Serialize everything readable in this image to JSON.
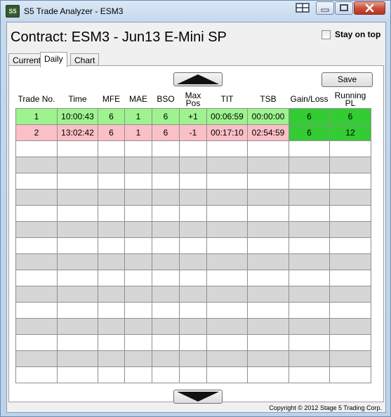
{
  "window": {
    "app_icon_text": "S5",
    "title": "S5 Trade Analyzer - ESM3"
  },
  "header": {
    "contract": "Contract: ESM3 - Jun13 E-Mini SP",
    "stay_on_top_label": "Stay on top",
    "stay_on_top_checked": false
  },
  "tabs": [
    {
      "label": "Current",
      "active": false
    },
    {
      "label": "Daily",
      "active": true
    },
    {
      "label": "Chart",
      "active": false
    }
  ],
  "toolbar": {
    "save_label": "Save"
  },
  "table": {
    "columns": [
      "Trade No.",
      "Time",
      "MFE",
      "MAE",
      "BSO",
      "Max\nPos",
      "TIT",
      "TSB",
      "Gain/Loss",
      "Running PL"
    ],
    "rows": [
      {
        "status": "win",
        "cells": [
          "1",
          "10:00:43",
          "6",
          "1",
          "6",
          "+1",
          "00:06:59",
          "00:00:00",
          "6",
          "6"
        ]
      },
      {
        "status": "loss",
        "cells": [
          "2",
          "13:02:42",
          "6",
          "1",
          "6",
          "-1",
          "00:17:10",
          "02:54:59",
          "6",
          "12"
        ]
      }
    ],
    "empty_rows": 15
  },
  "colors": {
    "win_row": "#9ef38f",
    "loss_row": "#fbbfc8",
    "money_cell": "#33cc33",
    "alt_row": "#d6d6d6"
  },
  "footer": {
    "copyright": "Copyright © 2012 Stage 5 Trading Corp."
  }
}
